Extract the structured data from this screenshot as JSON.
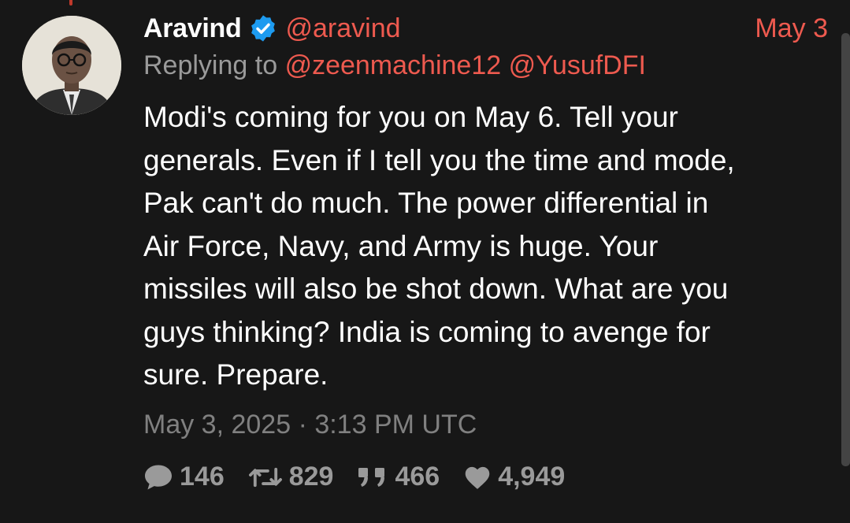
{
  "tweet": {
    "display_name": "Aravind",
    "verified": true,
    "handle": "@aravind",
    "short_date": "May 3",
    "replying_prefix": "Replying to",
    "replying_to": [
      "@zeenmachine12",
      "@YusufDFI"
    ],
    "text_lines": [
      "Modi's coming for you on May 6. Tell your",
      "generals. Even if I tell you the time and mode,",
      "Pak can't do much. The power differential in",
      "Air Force, Navy, and Army is huge. Your",
      "missiles will also be shot down. What are you",
      "guys thinking? India is coming to avenge for",
      "sure. Prepare."
    ],
    "timestamp": "May 3, 2025 · 3:13 PM UTC",
    "stats": {
      "replies": "146",
      "retweets": "829",
      "quotes": "466",
      "likes": "4,949"
    }
  },
  "icons": {
    "verified": "verified-badge-icon",
    "replies": "comment-icon",
    "retweets": "retweet-icon",
    "quotes": "quote-icon",
    "likes": "heart-icon"
  },
  "colors": {
    "background": "#171717",
    "accent": "#ee5a4f",
    "verified": "#1d9bf0",
    "muted": "#9a9a9a"
  }
}
